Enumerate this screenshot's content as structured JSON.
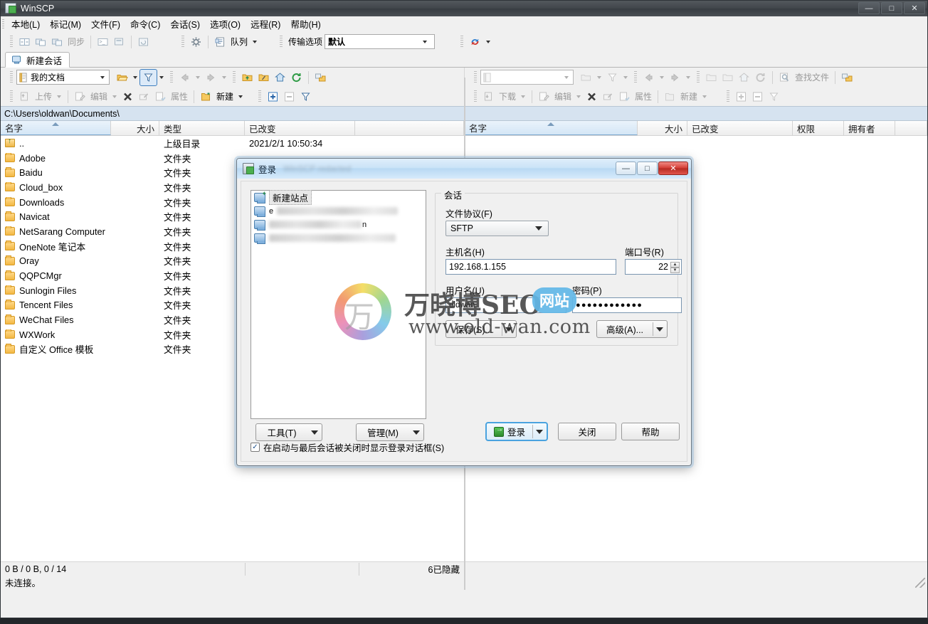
{
  "window": {
    "title": "WinSCP",
    "icon": "winscp-logo-icon",
    "buttons": {
      "minimize": "—",
      "maximize": "□",
      "close": "✕"
    }
  },
  "menubar": [
    {
      "label": "本地(L)",
      "name": "menu-local"
    },
    {
      "label": "标记(M)",
      "name": "menu-mark"
    },
    {
      "label": "文件(F)",
      "name": "menu-files"
    },
    {
      "label": "命令(C)",
      "name": "menu-commands"
    },
    {
      "label": "会话(S)",
      "name": "menu-session"
    },
    {
      "label": "选项(O)",
      "name": "menu-options"
    },
    {
      "label": "远程(R)",
      "name": "menu-remote"
    },
    {
      "label": "帮助(H)",
      "name": "menu-help"
    }
  ],
  "main_toolbar": {
    "sync_label": "同步",
    "queue_label": "队列",
    "transfer_settings_label": "传输选项",
    "transfer_settings_value": "默认"
  },
  "session_tab": {
    "label": "新建会话",
    "icon": "new-session-icon"
  },
  "local_panel": {
    "drive_label": "我的文档",
    "path": "C:\\Users\\oldwan\\Documents\\",
    "toolbar": {
      "upload": "上传",
      "edit": "编辑",
      "properties": "属性",
      "new": "新建"
    },
    "columns": [
      "名字",
      "大小",
      "类型",
      "已改变"
    ],
    "rows": [
      {
        "name": "..",
        "size": "",
        "type": "上级目录",
        "modified": "2021/2/1  10:50:34",
        "icon": "parent-directory-icon"
      },
      {
        "name": "Adobe",
        "size": "",
        "type": "文件夹",
        "modified": "",
        "icon": "folder-icon"
      },
      {
        "name": "Baidu",
        "size": "",
        "type": "文件夹",
        "modified": "",
        "icon": "folder-icon"
      },
      {
        "name": "Cloud_box",
        "size": "",
        "type": "文件夹",
        "modified": "",
        "icon": "folder-icon"
      },
      {
        "name": "Downloads",
        "size": "",
        "type": "文件夹",
        "modified": "",
        "icon": "folder-icon"
      },
      {
        "name": "Navicat",
        "size": "",
        "type": "文件夹",
        "modified": "",
        "icon": "folder-icon"
      },
      {
        "name": "NetSarang Computer",
        "size": "",
        "type": "文件夹",
        "modified": "",
        "icon": "folder-icon"
      },
      {
        "name": "OneNote 笔记本",
        "size": "",
        "type": "文件夹",
        "modified": "",
        "icon": "folder-icon"
      },
      {
        "name": "Oray",
        "size": "",
        "type": "文件夹",
        "modified": "",
        "icon": "folder-icon"
      },
      {
        "name": "QQPCMgr",
        "size": "",
        "type": "文件夹",
        "modified": "",
        "icon": "folder-icon"
      },
      {
        "name": "Sunlogin Files",
        "size": "",
        "type": "文件夹",
        "modified": "",
        "icon": "folder-icon"
      },
      {
        "name": "Tencent Files",
        "size": "",
        "type": "文件夹",
        "modified": "",
        "icon": "folder-icon"
      },
      {
        "name": "WeChat Files",
        "size": "",
        "type": "文件夹",
        "modified": "",
        "icon": "folder-icon"
      },
      {
        "name": "WXWork",
        "size": "",
        "type": "文件夹",
        "modified": "",
        "icon": "folder-icon"
      },
      {
        "name": "自定义 Office 模板",
        "size": "",
        "type": "文件夹",
        "modified": "",
        "icon": "folder-icon"
      }
    ]
  },
  "remote_panel": {
    "drive_label": "",
    "path": "",
    "toolbar": {
      "download": "下载",
      "edit": "编辑",
      "properties": "属性",
      "new": "新建",
      "find_files": "查找文件"
    },
    "columns": [
      "名字",
      "大小",
      "已改变",
      "权限",
      "拥有者"
    ],
    "rows": []
  },
  "statusbar": {
    "transfer": "0 B / 0 B,  0 / 14",
    "hidden": "6已隐藏",
    "connection": "未连接。"
  },
  "login_dialog": {
    "title": "登录",
    "buttons": {
      "minimize": "—",
      "maximize": "□",
      "close": "✕"
    },
    "tree": {
      "new_site": "新建站点",
      "items": [
        {
          "label_prefix": "e",
          "redacted": true
        },
        {
          "label_prefix": "",
          "redacted": true,
          "suffix": "n"
        },
        {
          "label_prefix": "",
          "redacted": true
        }
      ]
    },
    "session_group": {
      "title": "会话",
      "protocol_label": "文件协议(F)",
      "protocol_value": "SFTP",
      "host_label": "主机名(H)",
      "host_value": "192.168.1.155",
      "port_label": "端口号(R)",
      "port_value": "22",
      "username_label": "用户名(U)",
      "username_value": "oldwan",
      "password_label": "密码(P)",
      "password_value": "●●●●●●●●●●●●",
      "save_button": "保存(S)...",
      "advanced_button": "高级(A)..."
    },
    "tools_button": "工具(T)",
    "manage_button": "管理(M)",
    "login_button": "登录",
    "close_button": "关闭",
    "help_button": "帮助",
    "checkbox_label": "在启动与最后会话被关闭时显示登录对话框(S)",
    "checkbox_checked": "✓"
  },
  "watermark": {
    "glyph": "万",
    "text": "万晓博SEO",
    "badge": "网站",
    "url": "www.old-wan.com"
  },
  "colors": {
    "accent": "#4aa3df",
    "title_bg": "#41464b",
    "path_bg": "#d6e3f0",
    "folder": "#f3b843"
  }
}
